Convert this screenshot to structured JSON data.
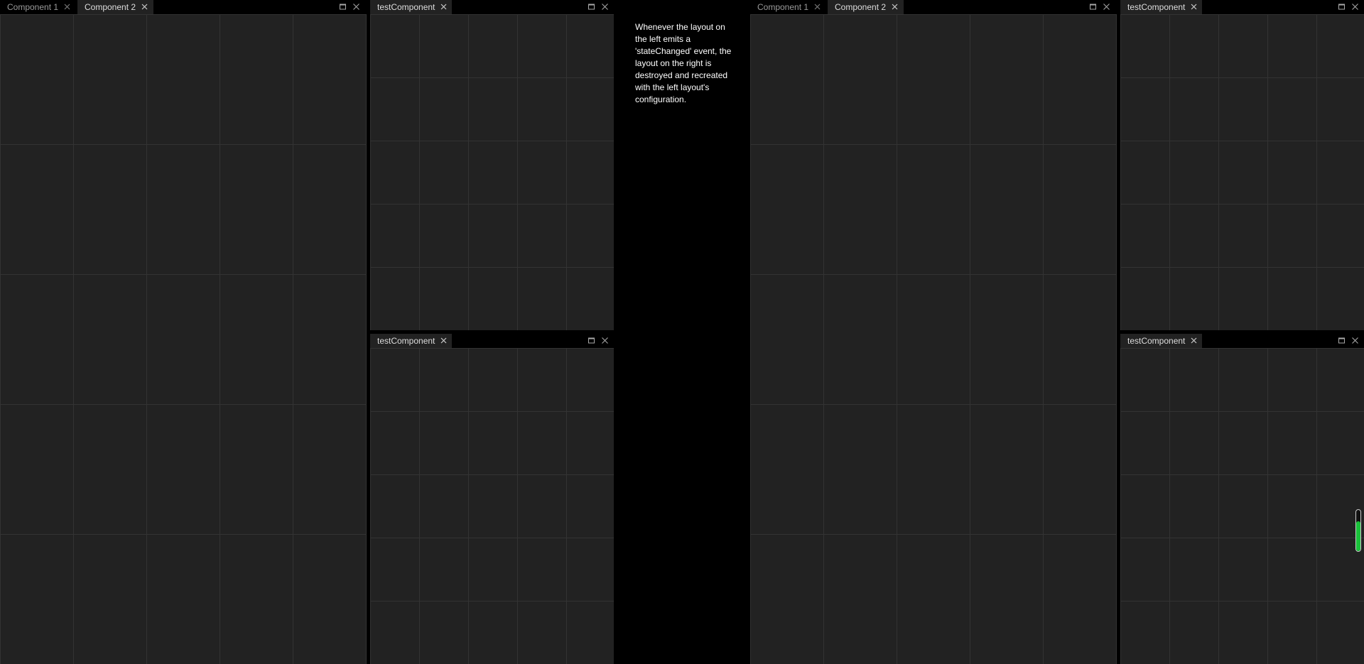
{
  "left_layout": {
    "main_stack": {
      "tabs": [
        {
          "label": "Component 1",
          "active": false
        },
        {
          "label": "Component 2",
          "active": true
        }
      ]
    },
    "top_stack": {
      "tabs": [
        {
          "label": "testComponent",
          "active": true
        }
      ]
    },
    "bottom_stack": {
      "tabs": [
        {
          "label": "testComponent",
          "active": true
        }
      ]
    }
  },
  "description": "Whenever the layout on the left emits a 'stateChanged' event, the layout on the right is destroyed and recreated with the left layout's configuration.",
  "right_layout": {
    "main_stack": {
      "tabs": [
        {
          "label": "Component 1",
          "active": false
        },
        {
          "label": "Component 2",
          "active": true
        }
      ]
    },
    "top_stack": {
      "tabs": [
        {
          "label": "testComponent",
          "active": true
        }
      ]
    },
    "bottom_stack": {
      "tabs": [
        {
          "label": "testComponent",
          "active": true
        }
      ]
    }
  },
  "icons": {
    "tab_close": "close-icon",
    "maximise": "maximise-icon",
    "stack_close": "close-icon"
  },
  "colors": {
    "background": "#000000",
    "panel": "#222222",
    "grid": "#333333",
    "active_tab_text": "#dddddd",
    "inactive_tab_text": "#999999",
    "scroll_fill": "#19c13a"
  },
  "scroll_indicator": {
    "level": 0.72
  }
}
